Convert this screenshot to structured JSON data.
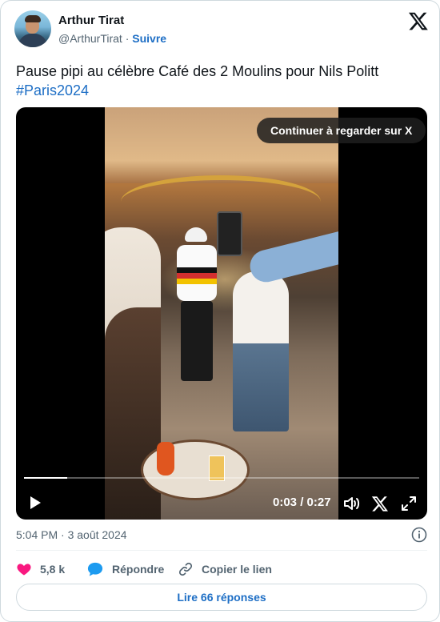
{
  "author": {
    "name": "Arthur Tirat",
    "handle": "@ArthurTirat",
    "separator": "·",
    "follow_label": "Suivre"
  },
  "tweet": {
    "text": "Pause pipi au célèbre Café des 2 Moulins pour Nils Politt",
    "hashtag": "#Paris2024"
  },
  "video": {
    "cta_label": "Continuer à regarder sur X",
    "time_label": "0:03 / 0:27",
    "progress_fraction": 0.11
  },
  "meta": {
    "timestamp": "5:04 PM · 3 août 2024"
  },
  "actions": {
    "likes": "5,8 k",
    "reply_label": "Répondre",
    "copy_label": "Copier le lien",
    "read_replies_label": "Lire 66 réponses"
  },
  "colors": {
    "link": "#1d6ec5",
    "like": "#f91880",
    "secondary_text": "#536471"
  },
  "icons": [
    "x-logo-icon",
    "info-icon",
    "heart-icon",
    "reply-bubble-icon",
    "link-icon",
    "play-icon",
    "volume-icon",
    "x-small-icon",
    "expand-icon"
  ]
}
